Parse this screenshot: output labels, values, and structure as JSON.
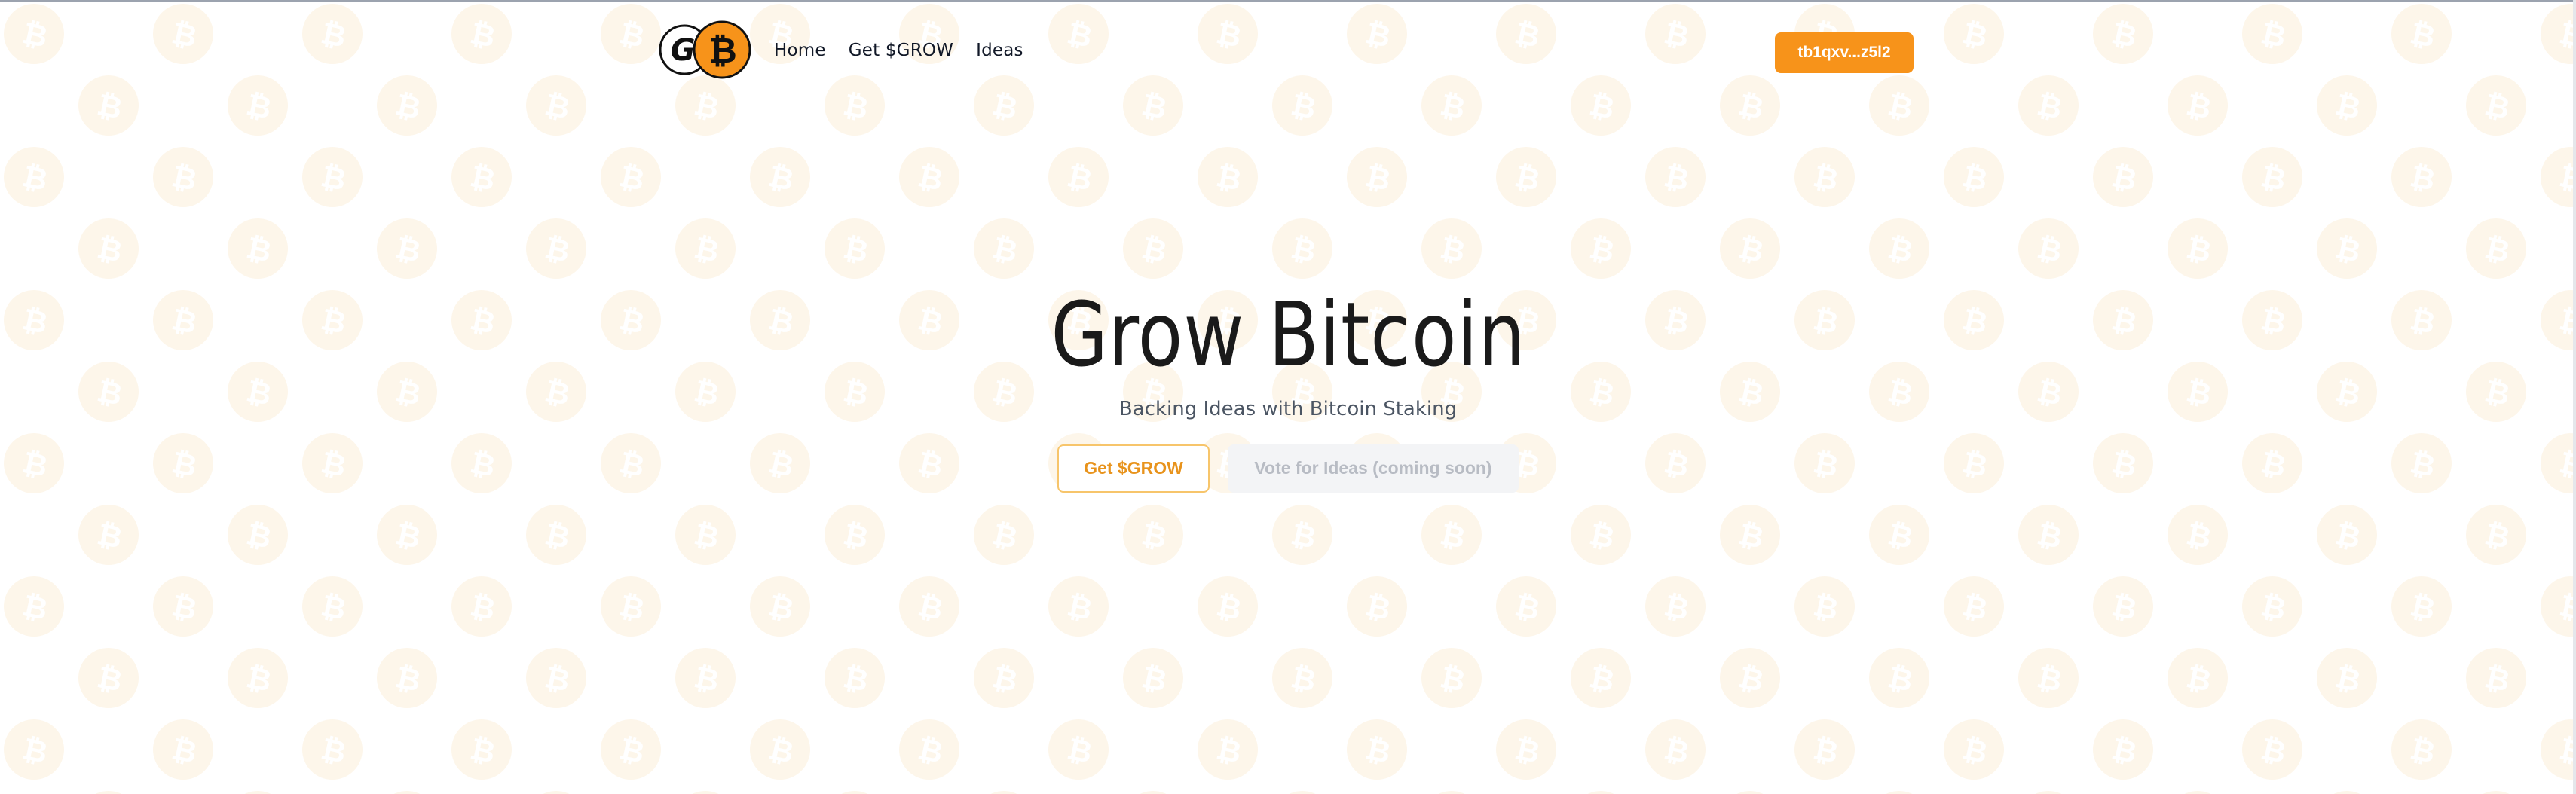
{
  "brand": {
    "logo_letter_left": "G",
    "logo_letter_right": "₿",
    "accent_color": "#f7931a"
  },
  "nav": {
    "items": [
      {
        "label": "Home"
      },
      {
        "label": "Get $GROW"
      },
      {
        "label": "Ideas"
      }
    ]
  },
  "wallet": {
    "address_label": "tb1qxv...z5l2"
  },
  "hero": {
    "title": "Grow Bitcoin",
    "subtitle": "Backing Ideas with Bitcoin Staking",
    "primary_button": "Get $GROW",
    "secondary_button": "Vote for Ideas (coming soon)"
  },
  "background": {
    "pattern_icon": "bitcoin-coin-icon"
  }
}
